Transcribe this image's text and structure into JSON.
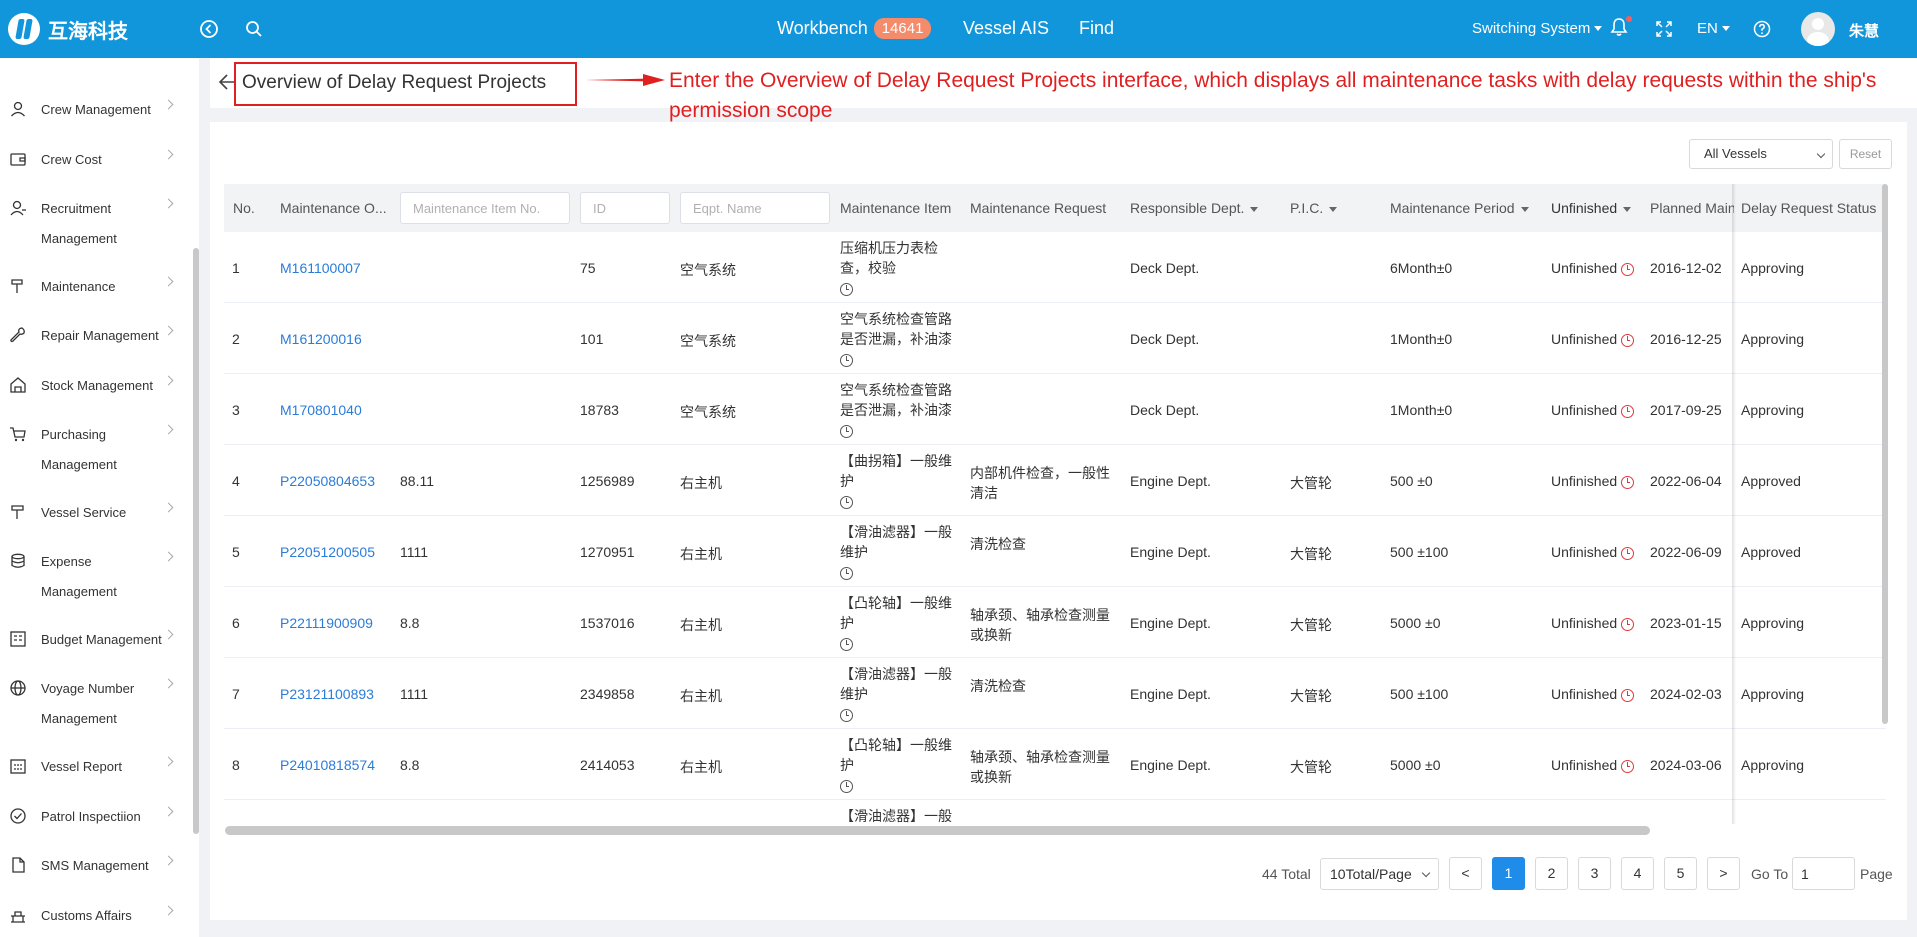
{
  "topbar": {
    "logo_text": "互海科技",
    "nav": {
      "workbench": "Workbench",
      "workbench_count": "14641",
      "vessel_ais": "Vessel AIS",
      "find": "Find"
    },
    "switching_system": "Switching System",
    "language": "EN",
    "user_name": "朱慧",
    "accent_color": "#1296db"
  },
  "sidebar": {
    "items": [
      {
        "label": "Crew Management",
        "icon": "user-icon"
      },
      {
        "label": "Crew Cost",
        "icon": "wallet-icon"
      },
      {
        "label": "Recruitment Management",
        "icon": "recruit-icon"
      },
      {
        "label": "Maintenance",
        "icon": "maintenance-icon"
      },
      {
        "label": "Repair Management",
        "icon": "wrench-icon"
      },
      {
        "label": "Stock Management",
        "icon": "warehouse-icon"
      },
      {
        "label": "Purchasing Management",
        "icon": "cart-icon"
      },
      {
        "label": "Vessel Service",
        "icon": "service-icon"
      },
      {
        "label": "Expense Management",
        "icon": "coins-icon"
      },
      {
        "label": "Budget Management",
        "icon": "budget-icon"
      },
      {
        "label": "Voyage Number Management",
        "icon": "globe-icon"
      },
      {
        "label": "Vessel Report",
        "icon": "calendar-icon"
      },
      {
        "label": "Patrol Inspectiion",
        "icon": "check-circle-icon"
      },
      {
        "label": "SMS Management",
        "icon": "document-icon"
      },
      {
        "label": "Customs Affairs",
        "icon": "customs-icon"
      }
    ]
  },
  "page": {
    "title": "Overview of Delay Request Projects",
    "annotation": "Enter the Overview of Delay Request Projects interface, which displays all maintenance tasks with delay requests within the ship's permission scope",
    "annotation_color": "#e02020"
  },
  "filters": {
    "vessel_select": "All Vessels",
    "reset": "Reset"
  },
  "table": {
    "headers": {
      "no": "No.",
      "maintenance_order": "Maintenance O...",
      "item_no_placeholder": "Maintenance Item No.",
      "id_placeholder": "ID",
      "eqpt_placeholder": "Eqpt. Name",
      "maintenance_item": "Maintenance Item",
      "maintenance_request": "Maintenance Request",
      "responsible_dept": "Responsible Dept.",
      "pic": "P.I.C.",
      "maintenance_period": "Maintenance Period",
      "unfinished": "Unfinished",
      "planned_maint": "Planned Maint",
      "delay_status": "Delay Request Status"
    },
    "rows": [
      {
        "no": "1",
        "order": "M161100007",
        "item_no": "",
        "id": "75",
        "eqpt": "空气系统",
        "item": "压缩机压力表检查，校验",
        "request": "",
        "dept": "Deck Dept.",
        "pic": "",
        "period": "6Month±0",
        "unfinished": "Unfinished",
        "planned": "2016-12-02",
        "status": "Approving"
      },
      {
        "no": "2",
        "order": "M161200016",
        "item_no": "",
        "id": "101",
        "eqpt": "空气系统",
        "item": "空气系统检查管路是否泄漏，补油漆",
        "request": "",
        "dept": "Deck Dept.",
        "pic": "",
        "period": "1Month±0",
        "unfinished": "Unfinished",
        "planned": "2016-12-25",
        "status": "Approving"
      },
      {
        "no": "3",
        "order": "M170801040",
        "item_no": "",
        "id": "18783",
        "eqpt": "空气系统",
        "item": "空气系统检查管路是否泄漏，补油漆",
        "request": "",
        "dept": "Deck Dept.",
        "pic": "",
        "period": "1Month±0",
        "unfinished": "Unfinished",
        "planned": "2017-09-25",
        "status": "Approving"
      },
      {
        "no": "4",
        "order": "P22050804653",
        "item_no": "88.11",
        "id": "1256989",
        "eqpt": "右主机",
        "item": "【曲拐箱】一般维护",
        "request": "内部机件检查，一般性清洁",
        "dept": "Engine Dept.",
        "pic": "大管轮",
        "period": "500 ±0",
        "unfinished": "Unfinished",
        "planned": "2022-06-04",
        "status": "Approved"
      },
      {
        "no": "5",
        "order": "P22051200505",
        "item_no": "1111",
        "id": "1270951",
        "eqpt": "右主机",
        "item": "【滑油滤器】一般维护",
        "request": "清洗检查",
        "dept": "Engine Dept.",
        "pic": "大管轮",
        "period": "500 ±100",
        "unfinished": "Unfinished",
        "planned": "2022-06-09",
        "status": "Approved"
      },
      {
        "no": "6",
        "order": "P22111900909",
        "item_no": "8.8",
        "id": "1537016",
        "eqpt": "右主机",
        "item": "【凸轮轴】一般维护",
        "request": "轴承颈、轴承检查测量或换新",
        "dept": "Engine Dept.",
        "pic": "大管轮",
        "period": "5000 ±0",
        "unfinished": "Unfinished",
        "planned": "2023-01-15",
        "status": "Approving"
      },
      {
        "no": "7",
        "order": "P23121100893",
        "item_no": "1111",
        "id": "2349858",
        "eqpt": "右主机",
        "item": "【滑油滤器】一般维护",
        "request": "清洗检查",
        "dept": "Engine Dept.",
        "pic": "大管轮",
        "period": "500 ±100",
        "unfinished": "Unfinished",
        "planned": "2024-02-03",
        "status": "Approving"
      },
      {
        "no": "8",
        "order": "P24010818574",
        "item_no": "8.8",
        "id": "2414053",
        "eqpt": "右主机",
        "item": "【凸轮轴】一般维护",
        "request": "轴承颈、轴承检查测量或换新",
        "dept": "Engine Dept.",
        "pic": "大管轮",
        "period": "5000 ±0",
        "unfinished": "Unfinished",
        "planned": "2024-03-06",
        "status": "Approving"
      },
      {
        "no": "",
        "order": "",
        "item_no": "",
        "id": "",
        "eqpt": "",
        "item": "【滑油滤器】一般",
        "request": "",
        "dept": "",
        "pic": "",
        "period": "",
        "unfinished": "",
        "planned": "",
        "status": ""
      }
    ]
  },
  "pagination": {
    "total": "44 Total",
    "page_size": "10Total/Page",
    "prev": "<",
    "pages": [
      "1",
      "2",
      "3",
      "4",
      "5"
    ],
    "next": ">",
    "goto_label": "Go To",
    "goto_value": "1",
    "page_label": "Page"
  }
}
